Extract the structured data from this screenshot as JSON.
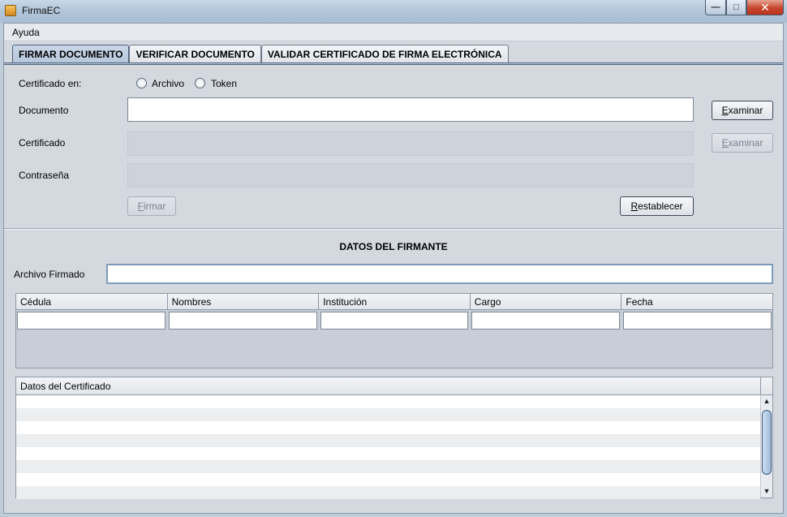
{
  "window": {
    "title": "FirmaEC"
  },
  "menu": {
    "help": "Ayuda"
  },
  "tabs": [
    {
      "label": "FIRMAR DOCUMENTO"
    },
    {
      "label": "VERIFICAR DOCUMENTO"
    },
    {
      "label": "VALIDAR CERTIFICADO DE FIRMA ELECTRÓNICA"
    }
  ],
  "sign": {
    "cert_in_label": "Certificado en:",
    "radio_file": "Archivo",
    "radio_token": "Token",
    "document_label": "Documento",
    "document_value": "",
    "certificate_label": "Certificado",
    "certificate_value": "",
    "password_label": "Contraseña",
    "password_value": "",
    "examine_label": {
      "underlined": "E",
      "rest": "xaminar"
    },
    "sign_button": {
      "underlined": "F",
      "rest": "irmar"
    },
    "reset_button": {
      "underlined": "R",
      "rest": "establecer"
    }
  },
  "signer": {
    "title": "DATOS DEL FIRMANTE",
    "signed_file_label": "Archivo Firmado",
    "signed_file_value": "",
    "columns": [
      "Cédula",
      "Nombres",
      "Institución",
      "Cargo",
      "Fecha"
    ]
  },
  "certificate_table": {
    "header": "Datos del Certificado"
  }
}
